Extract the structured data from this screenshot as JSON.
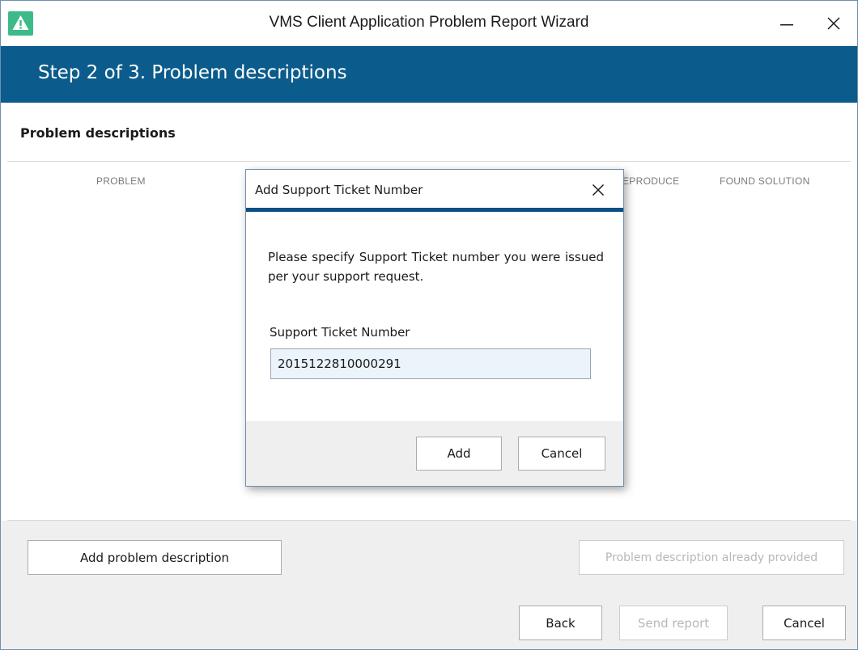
{
  "window": {
    "title": "VMS Client Application Problem Report Wizard",
    "icon": "warning-icon",
    "controls": [
      "minimize-icon",
      "close-icon"
    ]
  },
  "header": {
    "step_title": "Step 2 of 3. Problem descriptions"
  },
  "section": {
    "title": "Problem descriptions"
  },
  "table": {
    "columns": [
      "PROBLEM",
      "EPRODUCE",
      "FOUND SOLUTION"
    ]
  },
  "buttons": {
    "add_problem": "Add problem description",
    "already_provided": "Problem description already provided",
    "back": "Back",
    "send_report": "Send report",
    "cancel": "Cancel"
  },
  "dialog": {
    "title": "Add Support Ticket Number",
    "message": "Please specify Support Ticket number you were issued per your support request.",
    "field_label": "Support Ticket Number",
    "field_value": "2015122810000291",
    "add_label": "Add",
    "cancel_label": "Cancel"
  },
  "colors": {
    "header_band": "#0b5c8c",
    "dialog_rule": "#0b4f85",
    "app_icon": "#3cba8a"
  }
}
